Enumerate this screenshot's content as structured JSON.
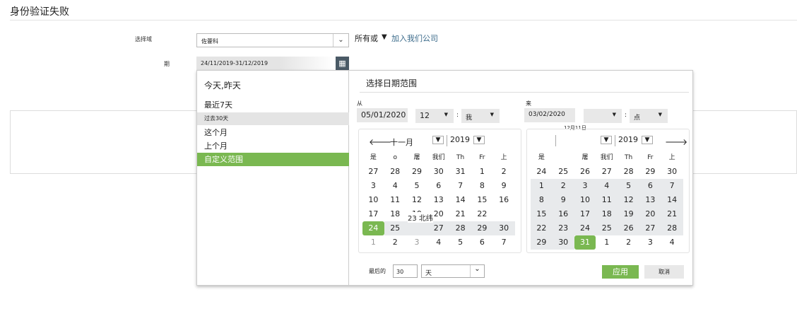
{
  "page": {
    "title": "身份验证失败"
  },
  "filters": {
    "domain_label": "选择域",
    "domain_value": "佐藿科",
    "all_or": "所有或",
    "join_link": "加入我们公司",
    "period_label": "期",
    "period_value": "24/11/2019-31/12/2019"
  },
  "presets": [
    "今天,昨天",
    "最近7天",
    "过去30天",
    "这个月",
    "上个月",
    "自定义范围"
  ],
  "range": {
    "title": "选择日期范围",
    "from_label": "从",
    "to_label": "来",
    "from_date": "05/01/2020",
    "from_hour": "12",
    "from_min": "我",
    "to_date": "03/02/2020",
    "to_hour": "",
    "to_min": "点",
    "tooltip": "12月11日",
    "overlay_text": "23 北纬"
  },
  "left_cal": {
    "month": "十一月",
    "year": "2019",
    "weekdays": [
      "是",
      "o",
      "屠",
      "我们",
      "Th",
      "Fr",
      "上"
    ],
    "rows": [
      [
        "27",
        "28",
        "29",
        "30",
        "31",
        "1",
        "2"
      ],
      [
        "3",
        "4",
        "5",
        "6",
        "7",
        "8",
        "9"
      ],
      [
        "10",
        "11",
        "12",
        "13",
        "14",
        "15",
        "16"
      ],
      [
        "17",
        "18",
        "19",
        "20",
        "21",
        "22",
        ""
      ],
      [
        "24",
        "25",
        "",
        "27",
        "28",
        "29",
        "30"
      ],
      [
        "1",
        "2",
        "3",
        "4",
        "5",
        "6",
        "7"
      ]
    ]
  },
  "right_cal": {
    "month": "",
    "year": "2019",
    "weekdays": [
      "是",
      "",
      "屠",
      "我们",
      "Th",
      "Fr",
      "上"
    ],
    "rows": [
      [
        "24",
        "25",
        "26",
        "27",
        "28",
        "29",
        "30"
      ],
      [
        "1",
        "2",
        "3",
        "4",
        "5",
        "6",
        "7"
      ],
      [
        "8",
        "9",
        "10",
        "11",
        "12",
        "13",
        "14"
      ],
      [
        "15",
        "16",
        "17",
        "18",
        "19",
        "20",
        "21"
      ],
      [
        "22",
        "23",
        "24",
        "25",
        "26",
        "27",
        "28"
      ],
      [
        "29",
        "30",
        "31",
        "1",
        "2",
        "3",
        "4"
      ]
    ]
  },
  "footer": {
    "last_label": "最后的",
    "last_value": "30",
    "unit": "天",
    "apply": "应用",
    "cancel": "取消"
  },
  "colors": {
    "accent": "#7ab851"
  }
}
